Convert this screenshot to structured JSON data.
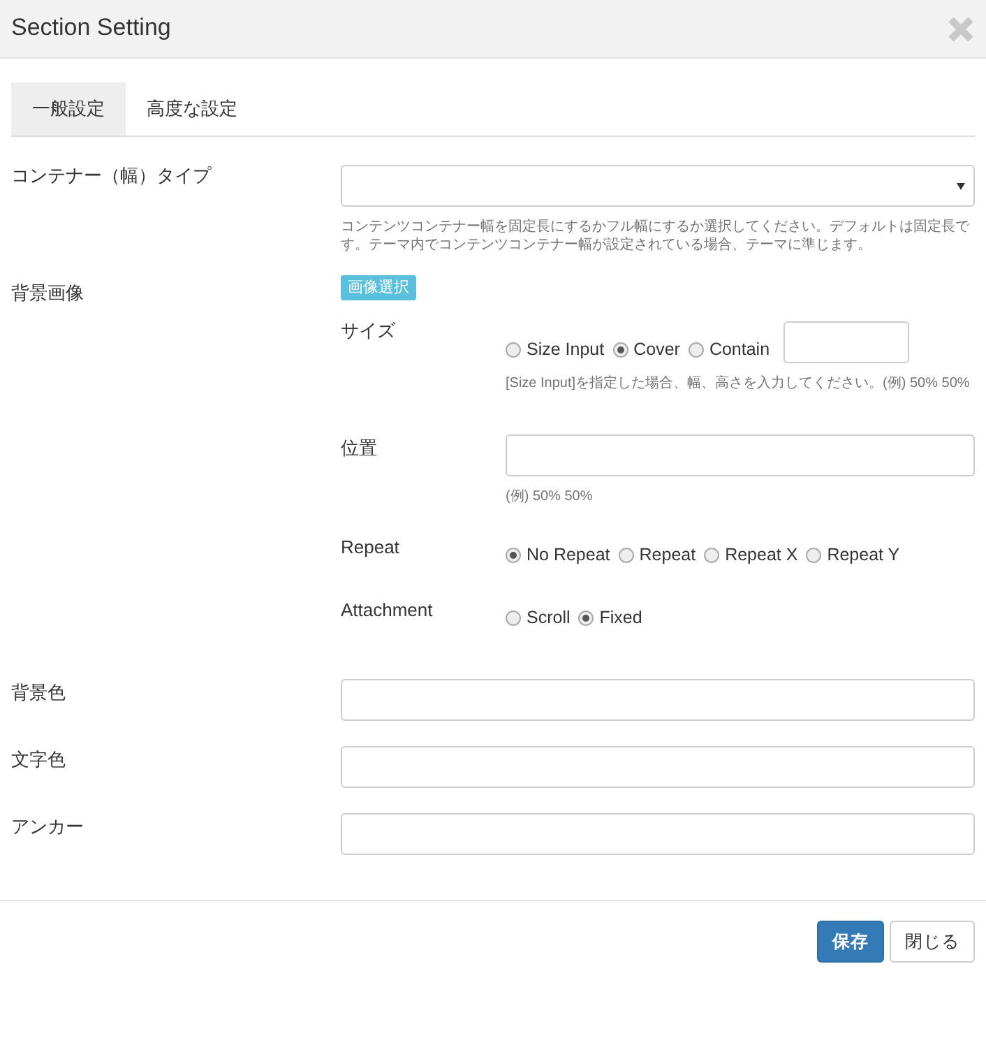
{
  "window": {
    "title": "Section Setting"
  },
  "tabs": [
    {
      "label": "一般設定",
      "selected": true
    },
    {
      "label": "高度な設定",
      "selected": false
    }
  ],
  "fields": [
    {
      "kind": "select",
      "label": "コンテナー（幅）タイプ",
      "help": "コンテンツコンテナー幅を固定長にするかフル幅にするか選択してください。デフォルトは固定長です。テーマ内でコンテンツコンテナー幅が設定されている場合、テーマに準じます。"
    },
    {
      "kind": "image",
      "label": "背景画像",
      "button": "画像選択",
      "sub": [
        {
          "kind": "radios_input",
          "label": "サイズ",
          "options": [
            {
              "label": "Size Input",
              "selected": false
            },
            {
              "label": "Cover",
              "selected": true
            },
            {
              "label": "Contain",
              "selected": false
            }
          ],
          "help": "[Size Input]を指定した場合、幅、高さを入力してください。(例) 50% 50%"
        },
        {
          "kind": "text",
          "label": "位置",
          "help": "(例) 50% 50%"
        },
        {
          "kind": "radios",
          "label": "Repeat",
          "options": [
            {
              "label": "No Repeat",
              "selected": true
            },
            {
              "label": "Repeat",
              "selected": false
            },
            {
              "label": "Repeat X",
              "selected": false
            },
            {
              "label": "Repeat Y",
              "selected": false
            }
          ]
        },
        {
          "kind": "radios",
          "label": "Attachment",
          "options": [
            {
              "label": "Scroll",
              "selected": false
            },
            {
              "label": "Fixed",
              "selected": true
            }
          ]
        }
      ]
    },
    {
      "kind": "text",
      "label": "背景色"
    },
    {
      "kind": "text",
      "label": "文字色"
    },
    {
      "kind": "text",
      "label": "アンカー"
    }
  ],
  "buttons": [
    {
      "label": "保存",
      "kind": "primary"
    },
    {
      "label": "閉じる",
      "kind": "default"
    }
  ]
}
